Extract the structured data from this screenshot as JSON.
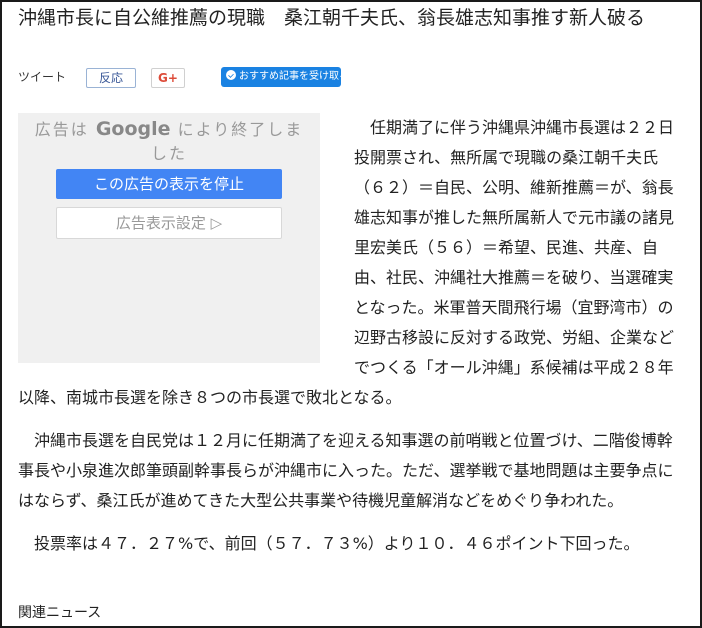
{
  "article": {
    "title": "沖縄市長に自公維推薦の現職　桑江朝千夫氏、翁長雄志知事推す新人破る",
    "paragraphs": [
      "任期満了に伴う沖縄県沖縄市長選は２２日投開票され、無所属で現職の桑江朝千夫氏（６２）＝自民、公明、維新推薦＝が、翁長雄志知事が推した無所属新人で元市議の諸見里宏美氏（５６）＝希望、民進、共産、自由、社民、沖縄社大推薦＝を破り、当選確実となった。米軍普天間飛行場（宜野湾市）の辺野古移設に反対する政党、労組、企業などでつくる「オール沖縄」系候補は平成２８年以降、南城市長選を除き８つの市長選で敗北となる。",
      "沖縄市長選を自民党は１２月に任期満了を迎える知事選の前哨戦と位置づけ、二階俊博幹事長や小泉進次郎筆頭副幹事長らが沖縄市に入った。ただ、選挙戦で基地問題は主要争点にはならず、桑江氏が進めてきた大型公共事業や待機児童解消などをめぐり争われた。",
      "投票率は４７．２７%で、前回（５７．７３%）より１０．４６ポイント下回った。"
    ],
    "related_label": "関連ニュース"
  },
  "social": {
    "tweet_label": "ツイート",
    "reaction_label": "反応",
    "gplus_label": "G+",
    "follow_label": "おすすめ記事を受け取る"
  },
  "ad": {
    "prefix": "広告は",
    "brand": "Google",
    "suffix": "により終了しました",
    "stop_label": "この広告の表示を停止",
    "settings_label": "広告表示設定 ▷"
  },
  "colors": {
    "follow_button": "#1a82e2",
    "ad_stop_button": "#4285f4",
    "ad_background": "#f0f0f0"
  }
}
